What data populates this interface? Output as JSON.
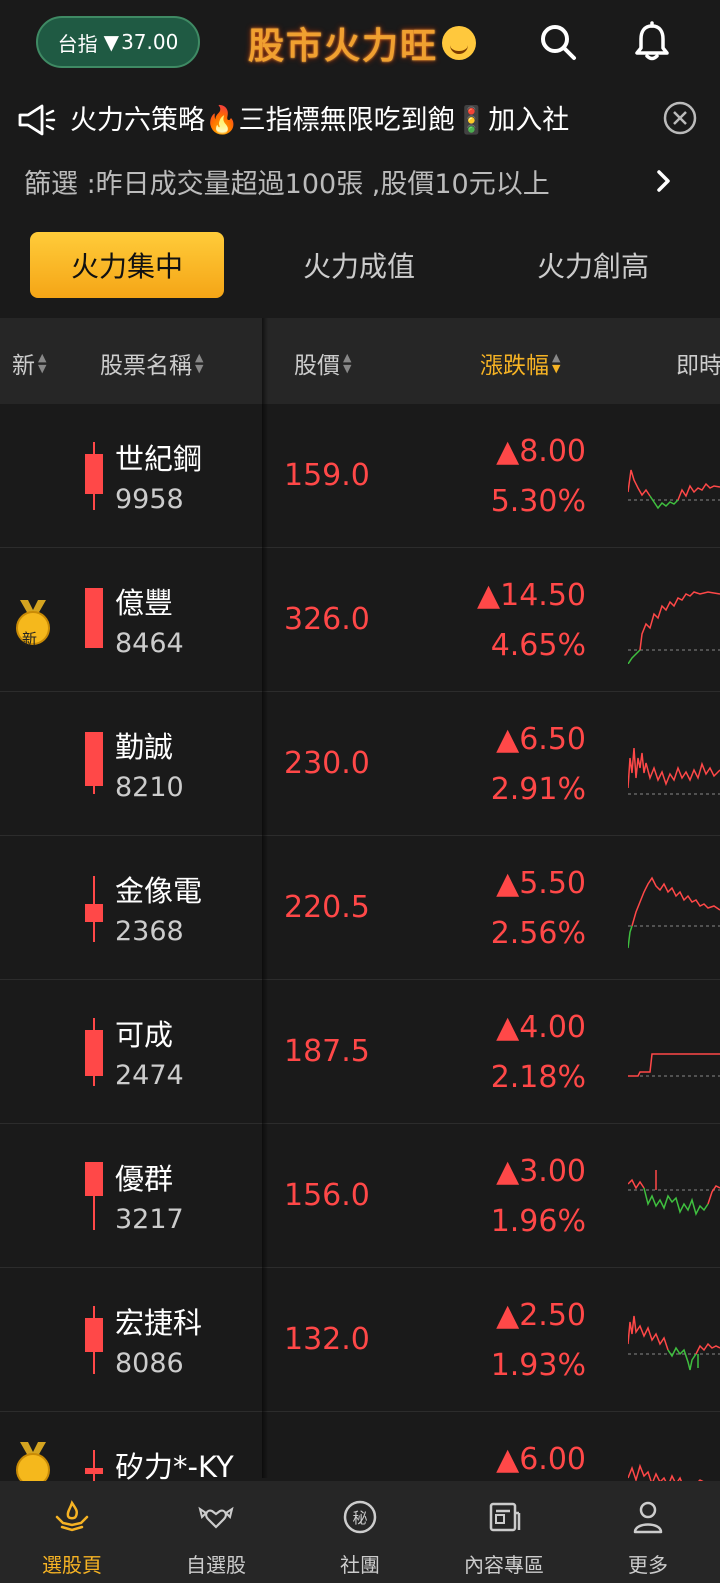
{
  "header": {
    "index_label": "台指",
    "index_arrow": "▼",
    "index_value": "37.00",
    "brand": "股市火力旺",
    "search_icon": "search-icon",
    "bell_icon": "bell-icon"
  },
  "announcement": {
    "icon": "megaphone-icon",
    "text": "火力六策略🔥三指標無限吃到飽🚦加入社",
    "close_icon": "close-circle-icon"
  },
  "filter": {
    "text": "篩選 :昨日成交量超過100張 ,股價10元以上",
    "chevron_icon": "chevron-right-icon"
  },
  "tabs": [
    {
      "label": "火力集中",
      "active": true
    },
    {
      "label": "火力成值",
      "active": false
    },
    {
      "label": "火力創高",
      "active": false
    }
  ],
  "columns": {
    "new": "新",
    "name": "股票名稱",
    "price": "股價",
    "change": "漲跌幅",
    "realtime": "即時"
  },
  "colors": {
    "up": "#ff4848",
    "down": "#3fbf3f",
    "accent": "#f6b324",
    "background": "#1a1a1a"
  },
  "stocks": [
    {
      "name": "世紀鋼",
      "code": "9958",
      "price": "159.0",
      "change": "▲8.00",
      "pct": "5.30%",
      "new_badge": false
    },
    {
      "name": "億豐",
      "code": "8464",
      "price": "326.0",
      "change": "▲14.50",
      "pct": "4.65%",
      "new_badge": true,
      "badge_text": "新"
    },
    {
      "name": "勤誠",
      "code": "8210",
      "price": "230.0",
      "change": "▲6.50",
      "pct": "2.91%",
      "new_badge": false
    },
    {
      "name": "金像電",
      "code": "2368",
      "price": "220.5",
      "change": "▲5.50",
      "pct": "2.56%",
      "new_badge": false
    },
    {
      "name": "可成",
      "code": "2474",
      "price": "187.5",
      "change": "▲4.00",
      "pct": "2.18%",
      "new_badge": false
    },
    {
      "name": "優群",
      "code": "3217",
      "price": "156.0",
      "change": "▲3.00",
      "pct": "1.96%",
      "new_badge": false
    },
    {
      "name": "宏捷科",
      "code": "8086",
      "price": "132.0",
      "change": "▲2.50",
      "pct": "1.93%",
      "new_badge": false
    },
    {
      "name": "矽力*-KY",
      "code": "",
      "price": "",
      "change": "▲6.00",
      "pct": "",
      "new_badge": true,
      "badge_text": ""
    }
  ],
  "bottom_nav": [
    {
      "label": "選股頁",
      "icon": "hands-flame-icon",
      "active": true
    },
    {
      "label": "自選股",
      "icon": "winged-heart-icon",
      "active": false
    },
    {
      "label": "社團",
      "icon": "secret-circle-icon",
      "active": false
    },
    {
      "label": "內容專區",
      "icon": "newspaper-icon",
      "active": false
    },
    {
      "label": "更多",
      "icon": "person-icon",
      "active": false
    }
  ]
}
